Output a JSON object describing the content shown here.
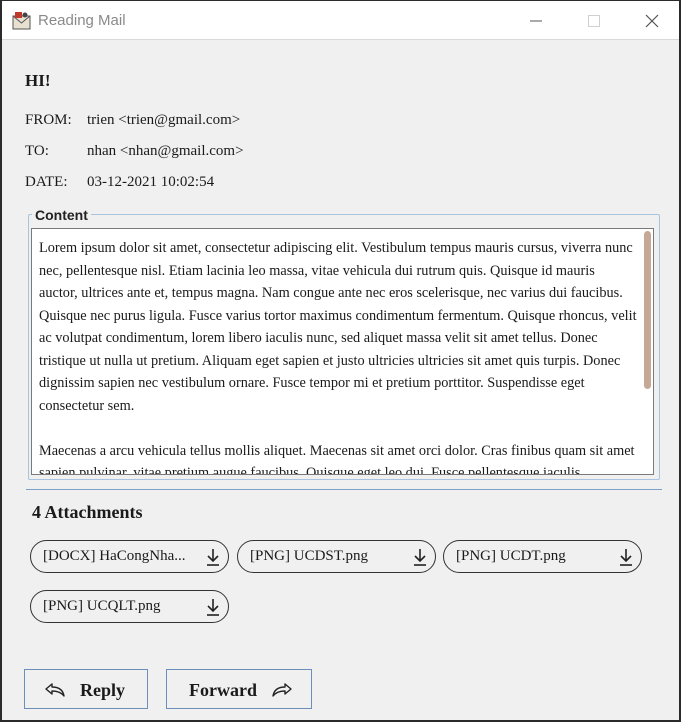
{
  "window": {
    "title": "Reading Mail",
    "icons": {
      "app": "mail-app-icon",
      "minimize": "minimize-icon",
      "maximize": "maximize-icon",
      "close": "close-icon"
    }
  },
  "mail": {
    "subject": "HI!",
    "from_label": "FROM:",
    "from_value": "trien <trien@gmail.com>",
    "to_label": "TO:",
    "to_value": "nhan <nhan@gmail.com>",
    "date_label": "DATE:",
    "date_value": "03-12-2021 10:02:54"
  },
  "content": {
    "legend": "Content",
    "paragraphs": [
      "Lorem ipsum dolor sit amet, consectetur adipiscing elit. Vestibulum tempus mauris cursus, viverra nunc nec, pellentesque nisl. Etiam lacinia leo massa, vitae vehicula dui rutrum quis. Quisque id mauris auctor, ultrices ante et, tempus magna. Nam congue ante nec eros scelerisque, nec varius dui faucibus. Quisque nec purus ligula. Fusce varius tortor maximus condimentum fermentum. Quisque rhoncus, velit ac volutpat condimentum, lorem libero iaculis nunc, sed aliquet massa velit sit amet tellus. Donec tristique ut nulla ut pretium. Aliquam eget sapien et justo ultricies ultricies sit amet quis turpis. Donec dignissim sapien nec vestibulum ornare. Fusce tempor mi et pretium porttitor. Suspendisse eget consectetur sem.",
      "Maecenas a arcu vehicula tellus mollis aliquet. Maecenas sit amet orci dolor. Cras finibus quam sit amet sapien pulvinar, vitae pretium augue faucibus. Quisque eget leo dui. Fusce pellentesque iaculis"
    ]
  },
  "attachments": {
    "title": "4 Attachments",
    "items": [
      {
        "label": "[DOCX] HaCongNha...",
        "icon": "download-icon"
      },
      {
        "label": "[PNG] UCDST.png",
        "icon": "download-icon"
      },
      {
        "label": "[PNG] UCDT.png",
        "icon": "download-icon"
      },
      {
        "label": "[PNG] UCQLT.png",
        "icon": "download-icon"
      }
    ]
  },
  "actions": {
    "reply_label": "Reply",
    "reply_icon": "reply-arrow-icon",
    "forward_label": "Forward",
    "forward_icon": "forward-arrow-icon"
  },
  "colors": {
    "window_bg": "#f0f0f0",
    "group_border": "#a9c4e0",
    "separator": "#7fa0c8",
    "scrollbar_thumb": "#c5a896"
  }
}
